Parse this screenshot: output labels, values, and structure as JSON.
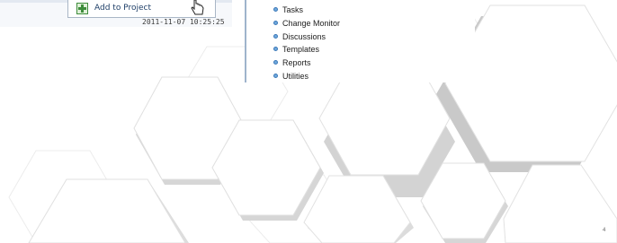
{
  "context_menu": {
    "add_to_project_label": "Add to Project",
    "partial_timestamp": "2011-11-07 10:25:25"
  },
  "nav_list": {
    "items": [
      {
        "label": "Tasks"
      },
      {
        "label": "Change Monitor"
      },
      {
        "label": "Discussions"
      },
      {
        "label": "Templates"
      },
      {
        "label": "Reports"
      },
      {
        "label": "Utilities"
      }
    ]
  },
  "slide": {
    "page_number": "4",
    "colors": {
      "background": "#ffffff",
      "hex_fill": "#ffffff",
      "hex_shadow": "#c9c9c9",
      "accent_blue": "#6fa8dc"
    }
  }
}
